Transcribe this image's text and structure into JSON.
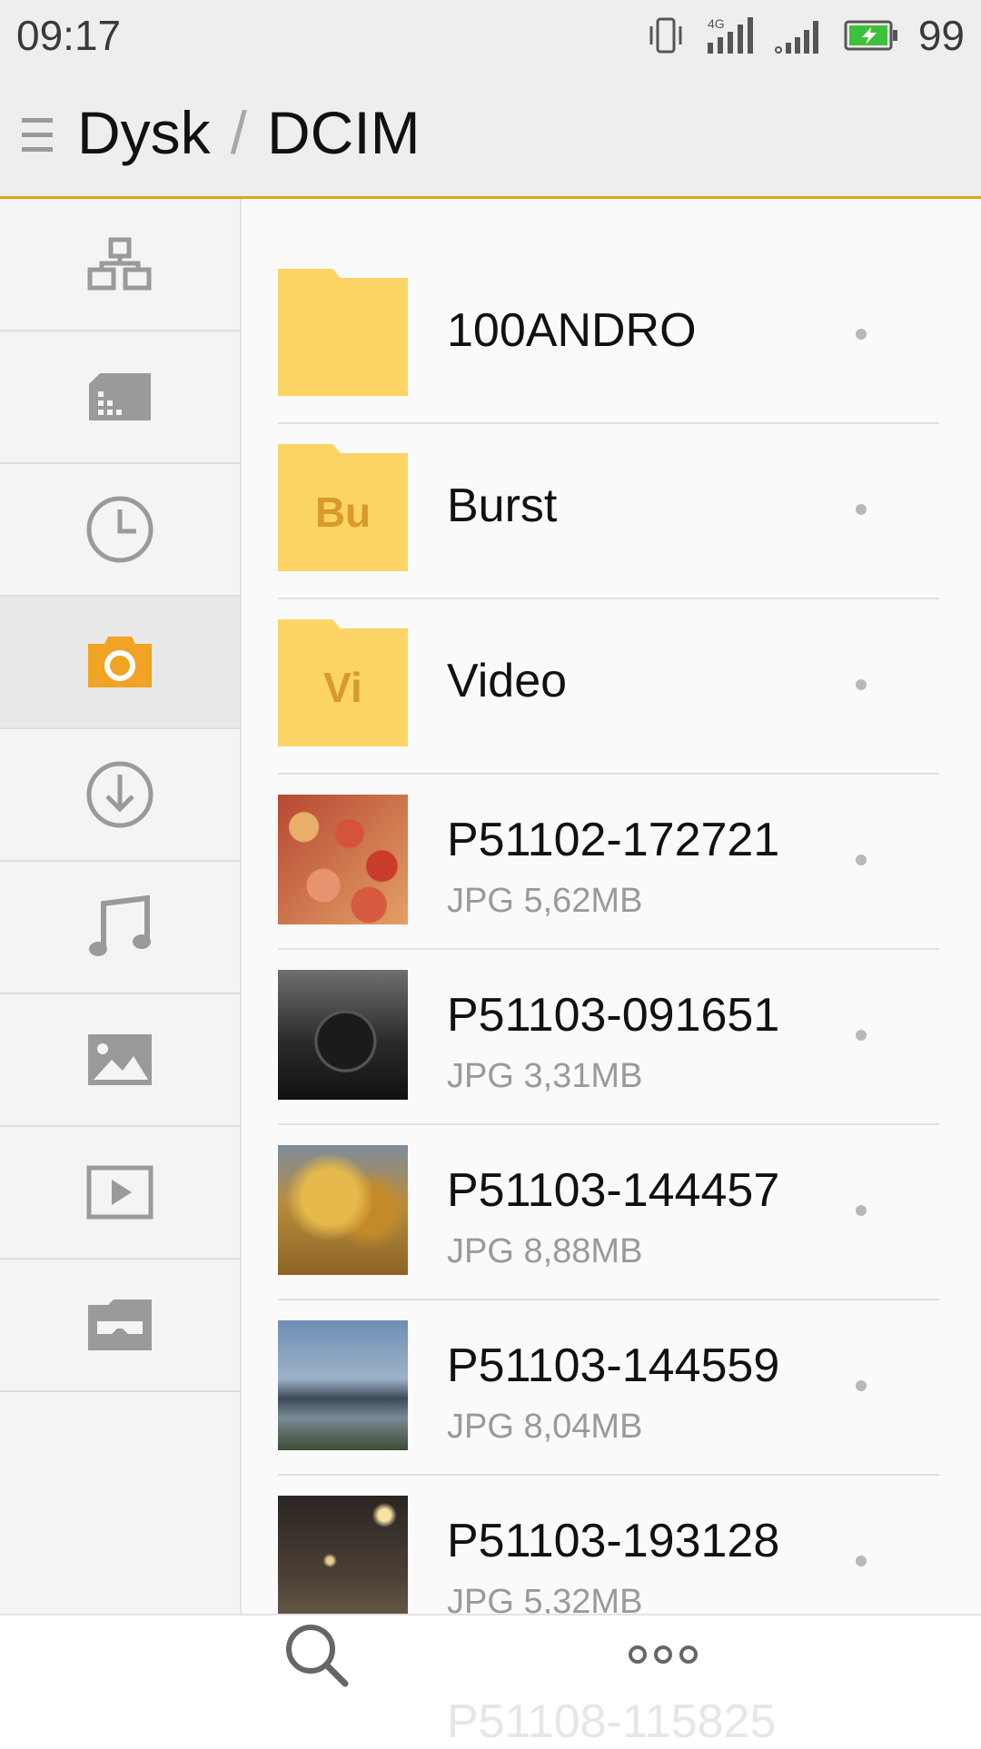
{
  "status_bar": {
    "time": "09:17",
    "network": "4G",
    "battery": "99",
    "icons": [
      "vibrate-icon",
      "signal-4g-icon",
      "signal-icon",
      "battery-charging-icon"
    ]
  },
  "header": {
    "menu_icon": "menu-icon",
    "crumbs": [
      "Dysk",
      "DCIM"
    ],
    "separator": "/",
    "accent_color": "#e2a21a"
  },
  "sidebar": {
    "items": [
      {
        "icon": "categories-icon"
      },
      {
        "icon": "sd-card-icon"
      },
      {
        "icon": "recent-clock-icon"
      },
      {
        "icon": "camera-icon",
        "active": true
      },
      {
        "icon": "download-icon"
      },
      {
        "icon": "music-icon"
      },
      {
        "icon": "image-icon"
      },
      {
        "icon": "video-icon"
      },
      {
        "icon": "vr-folder-icon"
      }
    ],
    "active_color": "#f0a324",
    "icon_color": "#9a9a9a"
  },
  "files": [
    {
      "name": "100ANDRO",
      "type": "folder",
      "abbr": ""
    },
    {
      "name": "Burst",
      "type": "folder",
      "abbr": "Bu"
    },
    {
      "name": "Video",
      "type": "folder",
      "abbr": "Vi"
    },
    {
      "name": "P51102-172721",
      "type": "file",
      "meta": "JPG 5,62MB",
      "thumb": "apples"
    },
    {
      "name": "P51103-091651",
      "type": "file",
      "meta": "JPG 3,31MB",
      "thumb": "gear-knob"
    },
    {
      "name": "P51103-144457",
      "type": "file",
      "meta": "JPG 8,88MB",
      "thumb": "autumn-tree"
    },
    {
      "name": "P51103-144559",
      "type": "file",
      "meta": "JPG 8,04MB",
      "thumb": "bridge"
    },
    {
      "name": "P51103-193128",
      "type": "file",
      "meta": "JPG 5,32MB",
      "thumb": "night-street"
    }
  ],
  "partial_next_file": "P51108-115825",
  "bottom_bar": {
    "search_icon": "search-icon",
    "more_icon": "more-dots-icon"
  }
}
